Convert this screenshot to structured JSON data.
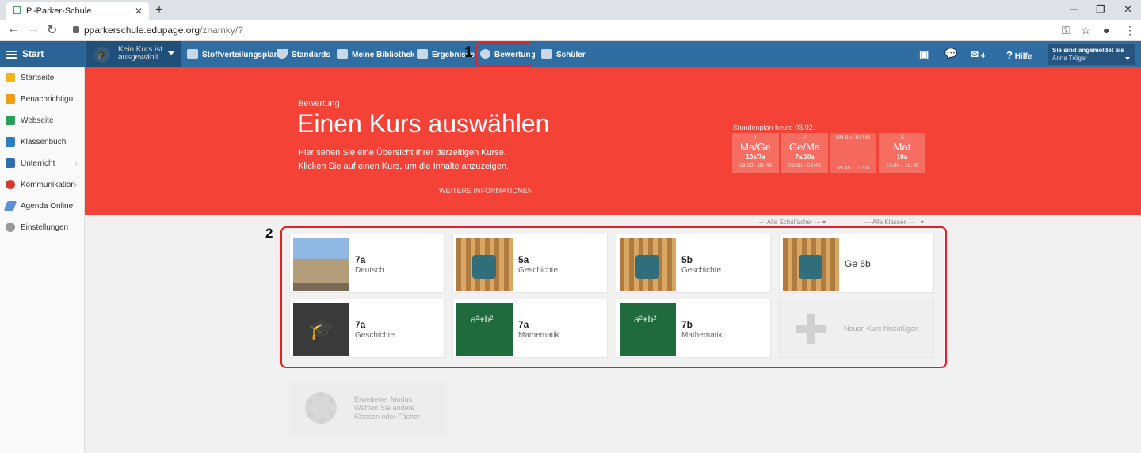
{
  "browser": {
    "tab_title": "P.-Parker-Schule",
    "url_host": "pparkerschule.edupage.org",
    "url_path": "/znamky/?"
  },
  "topnav": {
    "start": "Start",
    "course_selector": "Kein Kurs ist ausgewählt",
    "items": [
      "Stoffverteilungsplan",
      "Standards",
      "Meine Bibliothek",
      "Ergebnisse",
      "Bewertung",
      "Schüler"
    ],
    "messages_count": "4",
    "help": "Hilfe",
    "login_label": "Sie sind angemeldet als",
    "login_user": "Anna Tröger"
  },
  "annotations": {
    "marker1": "1",
    "marker2": "2",
    "highlight_color": "#e0232b"
  },
  "sidebar": {
    "items": [
      "Startseite",
      "Benachrichtigu...",
      "Webseite",
      "Klassenbuch",
      "Unterricht",
      "Kommunikation",
      "Agenda Online",
      "Einstellungen"
    ]
  },
  "hero": {
    "breadcrumb": "Bewertung",
    "title": "Einen Kurs auswählen",
    "description": "Hier sehen Sie eine Übersicht Ihrer derzeitigen Kurse. Klicken Sie auf einen Kurs, um die Inhalte anzuzeigen.",
    "more": "WEITERE INFORMATIONEN",
    "color": "#f44336"
  },
  "timetable": {
    "label": "Stundenplan heute 03.02.",
    "slots": [
      {
        "num": "1",
        "subject": "Ma/Ge",
        "class": "10a/7a",
        "time": "08:00 - 08:45"
      },
      {
        "num": "2",
        "subject": "Ge/Ma",
        "class": "7a/10a",
        "time": "09:00 - 09:45"
      },
      {
        "num": "09:45-10:00",
        "subject": "",
        "class": "",
        "time": "09:45 - 10:00"
      },
      {
        "num": "3",
        "subject": "Mat",
        "class": "10a",
        "time": "10:00 - 10:45"
      }
    ]
  },
  "filters": {
    "subjects": "--- Alle Schulfächer ---",
    "classes": "--- Alle Klassen ---"
  },
  "courses": [
    {
      "cls": "7a",
      "subject": "Deutsch"
    },
    {
      "cls": "5a",
      "subject": "Geschichte"
    },
    {
      "cls": "5b",
      "subject": "Geschichte"
    },
    {
      "cls": "Ge 6b",
      "subject": ""
    },
    {
      "cls": "7a",
      "subject": "Geschichte"
    },
    {
      "cls": "7a",
      "subject": "Mathematik"
    },
    {
      "cls": "7b",
      "subject": "Mathematik"
    }
  ],
  "add_course": "Neuen Kurs hinzufügen",
  "advanced": {
    "text": "Erweiterter Modus\nWählen Sie andere\nKlassen oder Fächer"
  }
}
